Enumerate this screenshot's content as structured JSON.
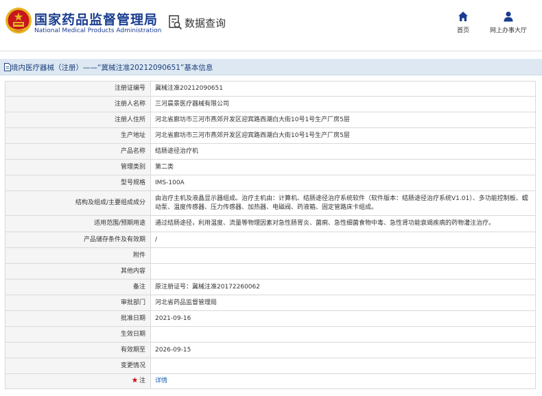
{
  "header": {
    "org_name_cn": "国家药品监督管理局",
    "org_name_en": "National Medical Products Administration",
    "query_title": "数据查询",
    "nav": [
      {
        "label": "首页",
        "icon": "home-icon"
      },
      {
        "label": "网上办事大厅",
        "icon": "user-icon"
      }
    ]
  },
  "page_title": "境内医疗器械（注册）——“冀械注准20212090651”基本信息",
  "colors": {
    "brand": "#1a3d8f",
    "title_bar": "#dde8f3",
    "label_bg": "#f5f5f5",
    "link": "#1a5fb4",
    "emblem_red": "#c8161d",
    "emblem_gold": "#e6b422"
  },
  "rows": [
    {
      "label": "注册证编号",
      "value": "冀械注准20212090651"
    },
    {
      "label": "注册人名称",
      "value": "三河晨景医疗器械有限公司"
    },
    {
      "label": "注册人住所",
      "value": "河北省廊坊市三河市燕郊开发区迎宾路西潮白大街10号1号生产厂房5层"
    },
    {
      "label": "生产地址",
      "value": "河北省廊坊市三河市燕郊开发区迎宾路西潮白大街10号1号生产厂房5层"
    },
    {
      "label": "产品名称",
      "value": "结肠途径治疗机"
    },
    {
      "label": "管理类别",
      "value": "第二类"
    },
    {
      "label": "型号规格",
      "value": "IMS-100A"
    },
    {
      "label": "结构及组成/主要组成成分",
      "value": "由治疗主机及液晶显示器组成。治疗主机由：计算机、结肠途径治疗系统软件（软件版本：结肠途径治疗系统V1.01）、多功能控制板、蠕动泵、温度传感器、压力传感器、加热器、电磁阀、药液箱、固定管路床卡组成。"
    },
    {
      "label": "适用范围/预期用途",
      "value": "通过结肠途径，利用温度、流量等物理因素对急性肠胃炎、菌痢、急性细菌食物中毒、急性肾功能衰竭疾病的药物灌注治疗。"
    },
    {
      "label": "产品储存条件及有效期",
      "value": "/"
    },
    {
      "label": "附件",
      "value": ""
    },
    {
      "label": "其他内容",
      "value": ""
    },
    {
      "label": "备注",
      "value": "原注册证号：冀械注准20172260062"
    },
    {
      "label": "审批部门",
      "value": "河北省药品监督管理局"
    },
    {
      "label": "批准日期",
      "value": "2021-09-16"
    },
    {
      "label": "生效日期",
      "value": ""
    },
    {
      "label": "有效期至",
      "value": "2026-09-15"
    },
    {
      "label": "变更情况",
      "value": ""
    },
    {
      "label": "注",
      "value": "详情",
      "label_icon": "star-icon"
    }
  ]
}
